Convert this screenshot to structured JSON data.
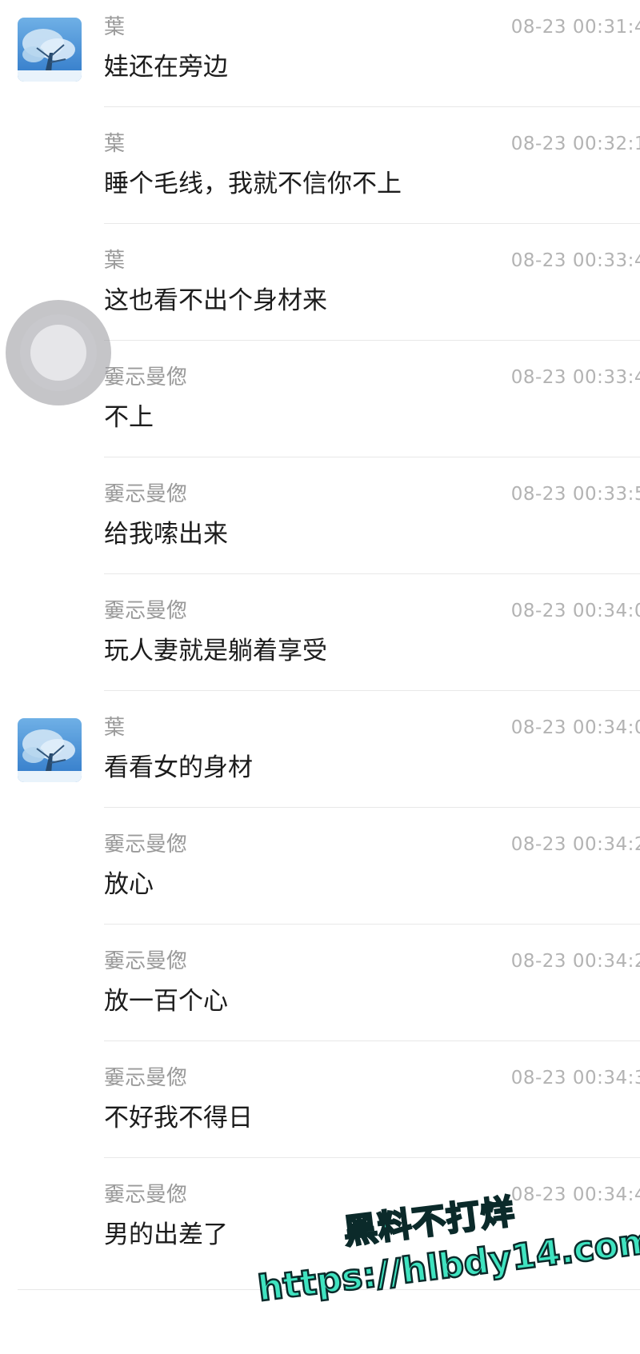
{
  "messages": [
    {
      "sender": "葉",
      "time": "08-23 00:31:4",
      "text": "娃还在旁边",
      "avatar": true
    },
    {
      "sender": "葉",
      "time": "08-23 00:32:1",
      "text": "睡个毛线，我就不信你不上",
      "avatar": false
    },
    {
      "sender": "葉",
      "time": "08-23 00:33:4",
      "text": "这也看不出个身材来",
      "avatar": false
    },
    {
      "sender": "嫑忈曼偬",
      "time": "08-23 00:33:4",
      "text": "不上",
      "avatar": false
    },
    {
      "sender": "嫑忈曼偬",
      "time": "08-23 00:33:5",
      "text": "给我嗦出来",
      "avatar": false
    },
    {
      "sender": "嫑忈曼偬",
      "time": "08-23 00:34:0",
      "text": "玩人妻就是躺着享受",
      "avatar": false
    },
    {
      "sender": "葉",
      "time": "08-23 00:34:0",
      "text": "看看女的身材",
      "avatar": true
    },
    {
      "sender": "嫑忈曼偬",
      "time": "08-23 00:34:2",
      "text": "放心",
      "avatar": false
    },
    {
      "sender": "嫑忈曼偬",
      "time": "08-23 00:34:2",
      "text": "放一百个心",
      "avatar": false
    },
    {
      "sender": "嫑忈曼偬",
      "time": "08-23 00:34:3",
      "text": "不好我不得日",
      "avatar": false
    },
    {
      "sender": "嫑忈曼偬",
      "time": "08-23 00:34:4",
      "text": "男的出差了",
      "avatar": false
    }
  ],
  "avatar_icon": "snowy-tree-photo",
  "assistive_touch_icon": "assistive-touch-button",
  "watermark": {
    "line1": "黑料不打烊",
    "line2": "https://hlbdy14.com"
  },
  "colors": {
    "sender": "#9a9a9a",
    "time": "#b3b3b3",
    "body": "#1c1c1c",
    "divider": "#e8e8e8",
    "watermark_fill": "#3fe3c0"
  }
}
